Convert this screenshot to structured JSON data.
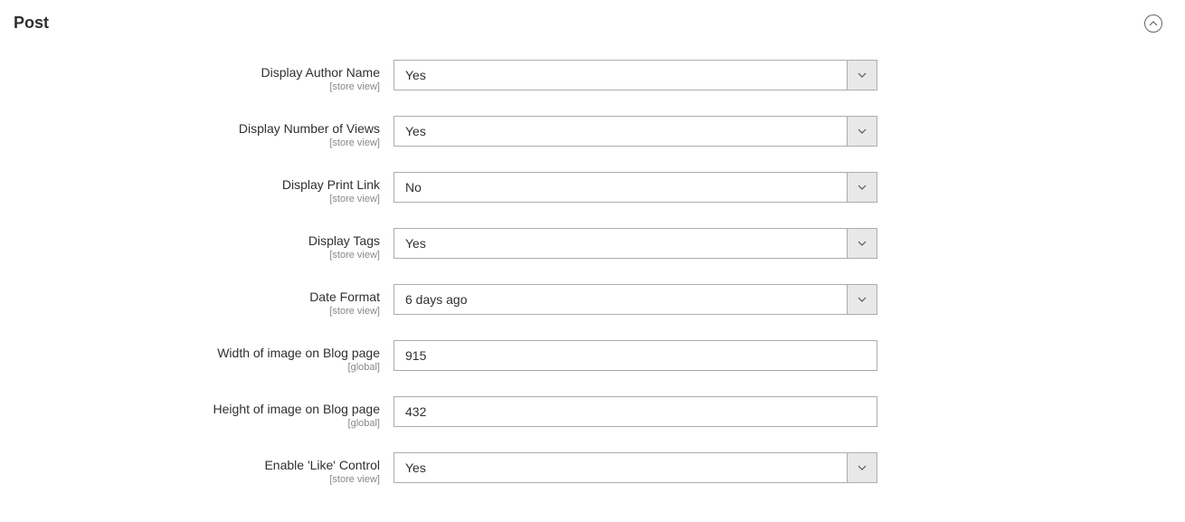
{
  "section": {
    "title": "Post"
  },
  "fields": {
    "displayAuthorName": {
      "label": "Display Author Name",
      "scope": "[store view]",
      "value": "Yes"
    },
    "displayNumberOfViews": {
      "label": "Display Number of Views",
      "scope": "[store view]",
      "value": "Yes"
    },
    "displayPrintLink": {
      "label": "Display Print Link",
      "scope": "[store view]",
      "value": "No"
    },
    "displayTags": {
      "label": "Display Tags",
      "scope": "[store view]",
      "value": "Yes"
    },
    "dateFormat": {
      "label": "Date Format",
      "scope": "[store view]",
      "value": "6 days ago"
    },
    "widthImageBlog": {
      "label": "Width of image on Blog page",
      "scope": "[global]",
      "value": "915"
    },
    "heightImageBlog": {
      "label": "Height of image on Blog page",
      "scope": "[global]",
      "value": "432"
    },
    "enableLikeControl": {
      "label": "Enable 'Like' Control",
      "scope": "[store view]",
      "value": "Yes"
    }
  }
}
